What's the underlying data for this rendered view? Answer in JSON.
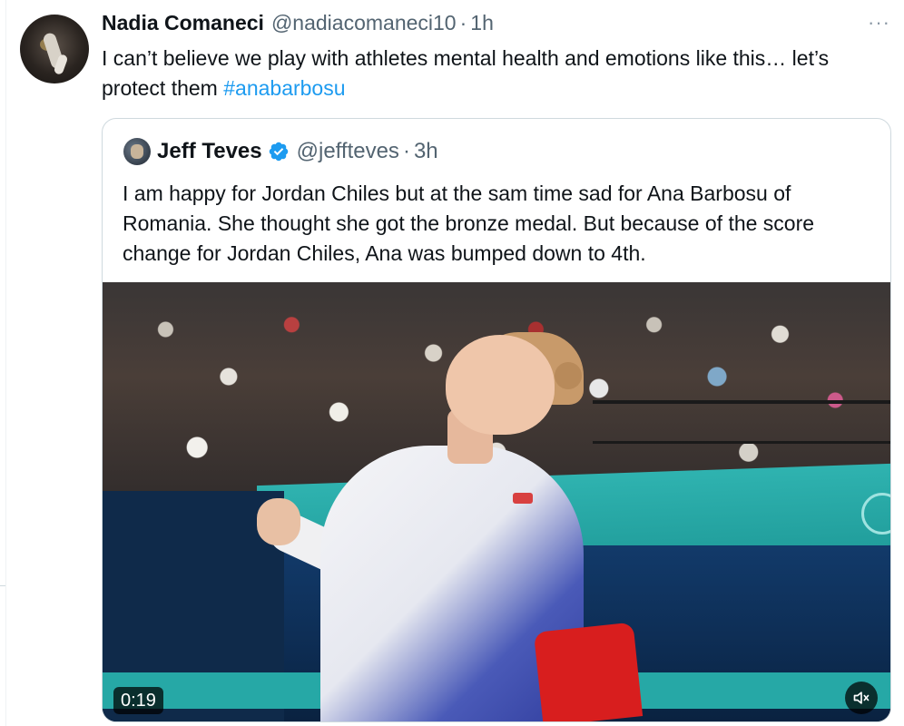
{
  "tweet": {
    "author_name": "Nadia Comaneci",
    "author_handle": "@nadiacomaneci10",
    "separator": "·",
    "time": "1h",
    "more_label": "···",
    "text_main": "I can’t believe we play with athletes mental health and emotions like this… let’s protect them ",
    "hashtag": "#anabarbosu"
  },
  "quoted": {
    "author_name": "Jeff Teves",
    "author_handle": "@jeffteves",
    "separator": "·",
    "time": "3h",
    "verified": true,
    "text": "I am happy for Jordan Chiles but at the sam time sad for Ana Barbosu of Romania. She thought she got the bronze medal. But because of the score change for Jordan Chiles, Ana was bumped down to 4th.",
    "video": {
      "duration": "0:19",
      "muted": true
    }
  },
  "colors": {
    "link": "#1d9bf0",
    "secondary_text": "#536471",
    "border": "#cfd9de"
  }
}
